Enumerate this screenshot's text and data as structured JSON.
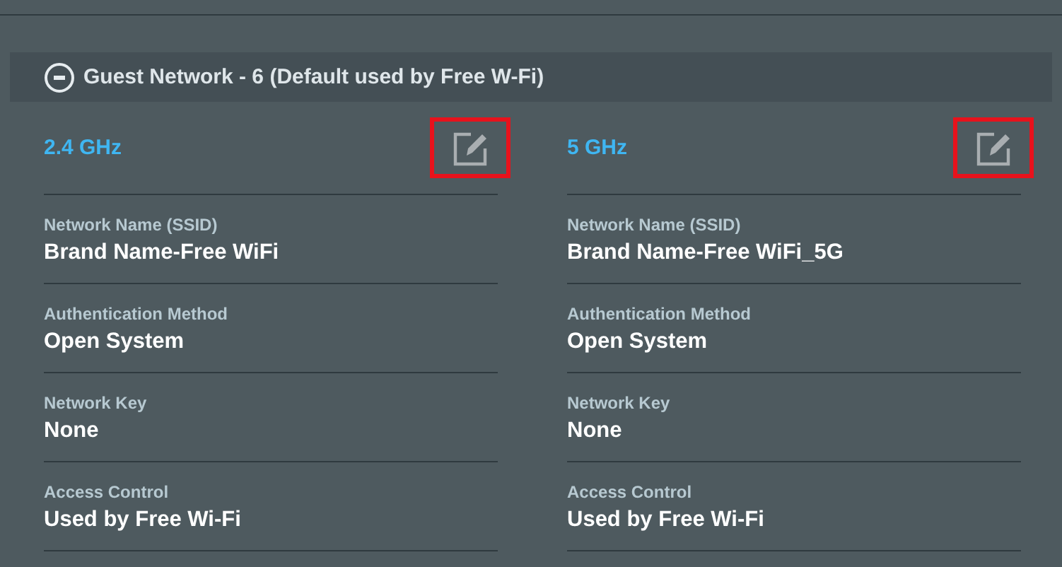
{
  "section": {
    "title": "Guest Network - 6 (Default used by Free W-Fi)",
    "expanded": true
  },
  "bands": [
    {
      "title": "2.4 GHz",
      "fields": [
        {
          "label": "Network Name (SSID)",
          "value": "Brand Name-Free WiFi"
        },
        {
          "label": "Authentication Method",
          "value": "Open System"
        },
        {
          "label": "Network Key",
          "value": "None"
        },
        {
          "label": "Access Control",
          "value": "Used by Free Wi-Fi"
        }
      ]
    },
    {
      "title": "5 GHz",
      "fields": [
        {
          "label": "Network Name (SSID)",
          "value": "Brand Name-Free WiFi_5G"
        },
        {
          "label": "Authentication Method",
          "value": "Open System"
        },
        {
          "label": "Network Key",
          "value": "None"
        },
        {
          "label": "Access Control",
          "value": "Used by Free Wi-Fi"
        }
      ]
    }
  ]
}
